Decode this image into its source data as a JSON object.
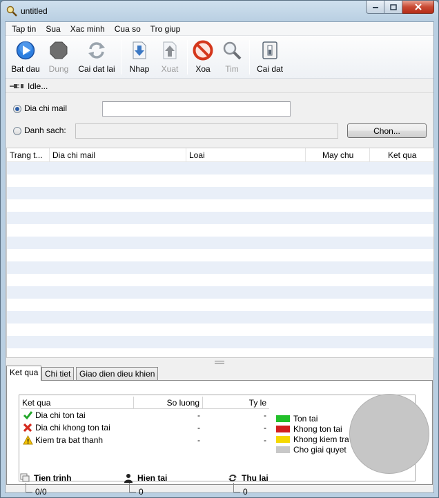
{
  "window": {
    "title": "untitled"
  },
  "menu": [
    "Tap tin",
    "Sua",
    "Xac minh",
    "Cua so",
    "Tro giup"
  ],
  "toolbar": {
    "start": "Bat dau",
    "stop": "Dung",
    "reset": "Cai dat lai",
    "import": "Nhap",
    "export": "Xuat",
    "delete": "Xoa",
    "find": "Tim",
    "settings": "Cai dat"
  },
  "status": {
    "text": "Idle..."
  },
  "form": {
    "email_label": "Dia chi mail",
    "email_value": "",
    "list_label": "Danh sach:",
    "list_value": "",
    "choose_button": "Chon..."
  },
  "grid": {
    "columns": [
      "Trang t...",
      "Dia chi mail",
      "Loai",
      "May chu",
      "Ket qua"
    ],
    "rows": []
  },
  "tabs": [
    "Ket qua",
    "Chi tiet",
    "Giao dien dieu khien"
  ],
  "results": {
    "headers": {
      "result": "Ket qua",
      "count": "So luong",
      "ratio": "Ty le"
    },
    "rows": [
      {
        "label": "Dia chi ton tai",
        "count": "-",
        "ratio": "-",
        "icon": "check-icon"
      },
      {
        "label": "Dia chi khong ton tai",
        "count": "-",
        "ratio": "-",
        "icon": "cross-icon"
      },
      {
        "label": "Kiem tra bat thanh",
        "count": "-",
        "ratio": "-",
        "icon": "warning-icon"
      }
    ],
    "legend": [
      {
        "label": "Ton tai",
        "color": "#22c02a"
      },
      {
        "label": "Khong ton tai",
        "color": "#d21e1e"
      },
      {
        "label": "Khong kiem tra",
        "color": "#f5d800"
      },
      {
        "label": "Cho giai quyet",
        "color": "#c8c8c8"
      }
    ],
    "stats": {
      "progress_label": "Tien trinh",
      "progress_value": "0/0",
      "current_label": "Hien tai",
      "current_value": "0",
      "retry_label": "Thu lai",
      "retry_value": "0"
    }
  }
}
